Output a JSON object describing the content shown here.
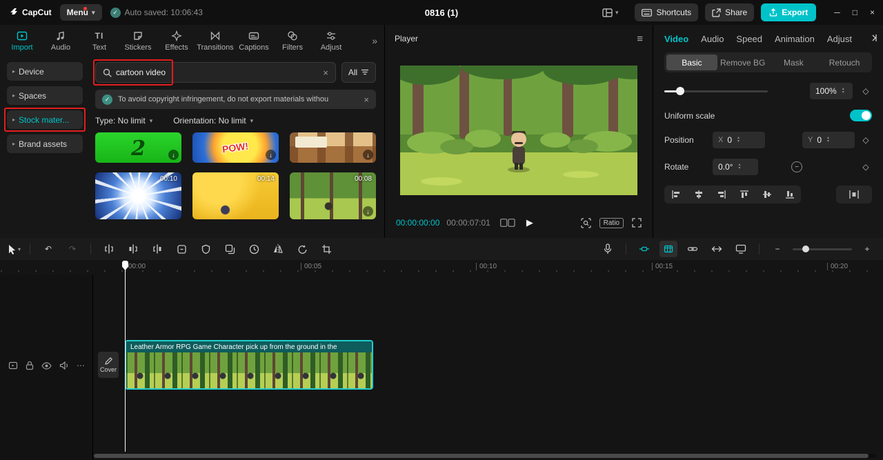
{
  "accent": "#00c3c9",
  "annotation_color": "#e51c1c",
  "icons": {
    "chevron_down": "▾",
    "chevron_right": "▸",
    "double_chevron": "»",
    "close": "×",
    "undo": "↶",
    "redo": "↷",
    "play": "▶",
    "hamburger": "≡",
    "diamond": "◇",
    "more": "⋯",
    "minus": "−",
    "plus": "+",
    "check": "✓",
    "minimize": "─",
    "maximize": "□",
    "download": "↓",
    "text_tool": "TI",
    "stepper_up": "▴",
    "stepper_down": "▾"
  },
  "titlebar": {
    "logo_text": "CapCut",
    "menu_label": "Menu",
    "autosave_text": "Auto saved: 10:06:43",
    "doc_title": "0816 (1)",
    "shortcuts_label": "Shortcuts",
    "share_label": "Share",
    "export_label": "Export"
  },
  "media_panel": {
    "tabs": [
      {
        "label": "Import"
      },
      {
        "label": "Audio"
      },
      {
        "label": "Text"
      },
      {
        "label": "Stickers"
      },
      {
        "label": "Effects"
      },
      {
        "label": "Transitions"
      },
      {
        "label": "Captions"
      },
      {
        "label": "Filters"
      },
      {
        "label": "Adjust"
      }
    ],
    "sidebar_items": [
      {
        "label": "Device"
      },
      {
        "label": "Spaces"
      },
      {
        "label": "Stock mater..."
      },
      {
        "label": "Brand assets"
      }
    ],
    "search_value": "cartoon video",
    "all_filter_label": "All",
    "banner_text": "To avoid copyright infringement, do not export materials withou",
    "type_filter": "Type: No limit",
    "orientation_filter": "Orientation: No limit",
    "thumbnails": [
      {
        "overlay_text": "2"
      },
      {
        "overlay_text": "POW!"
      },
      {},
      {
        "duration": "00:10"
      },
      {
        "duration": "00:14"
      },
      {
        "duration": "00:08"
      }
    ]
  },
  "player": {
    "title": "Player",
    "current_time": "00:00:00:00",
    "duration": "00:00:07:01",
    "ratio_label": "Ratio"
  },
  "properties": {
    "tabs": [
      {
        "label": "Video"
      },
      {
        "label": "Audio"
      },
      {
        "label": "Speed"
      },
      {
        "label": "Animation"
      },
      {
        "label": "Adjust"
      }
    ],
    "subtabs": [
      {
        "label": "Basic"
      },
      {
        "label": "Remove BG"
      },
      {
        "label": "Mask"
      },
      {
        "label": "Retouch"
      }
    ],
    "scale_value": "100%",
    "uniform_scale_label": "Uniform scale",
    "position_label": "Position",
    "x_label": "X",
    "x_value": "0",
    "y_label": "Y",
    "y_value": "0",
    "rotate_label": "Rotate",
    "rotate_value": "0.0°"
  },
  "timeline": {
    "ruler_marks": [
      "00:00",
      "00:05",
      "00:10",
      "00:15",
      "00:20"
    ],
    "clip_title": "Leather Armor RPG Game Character pick up from the ground in the",
    "cover_label": "Cover"
  }
}
